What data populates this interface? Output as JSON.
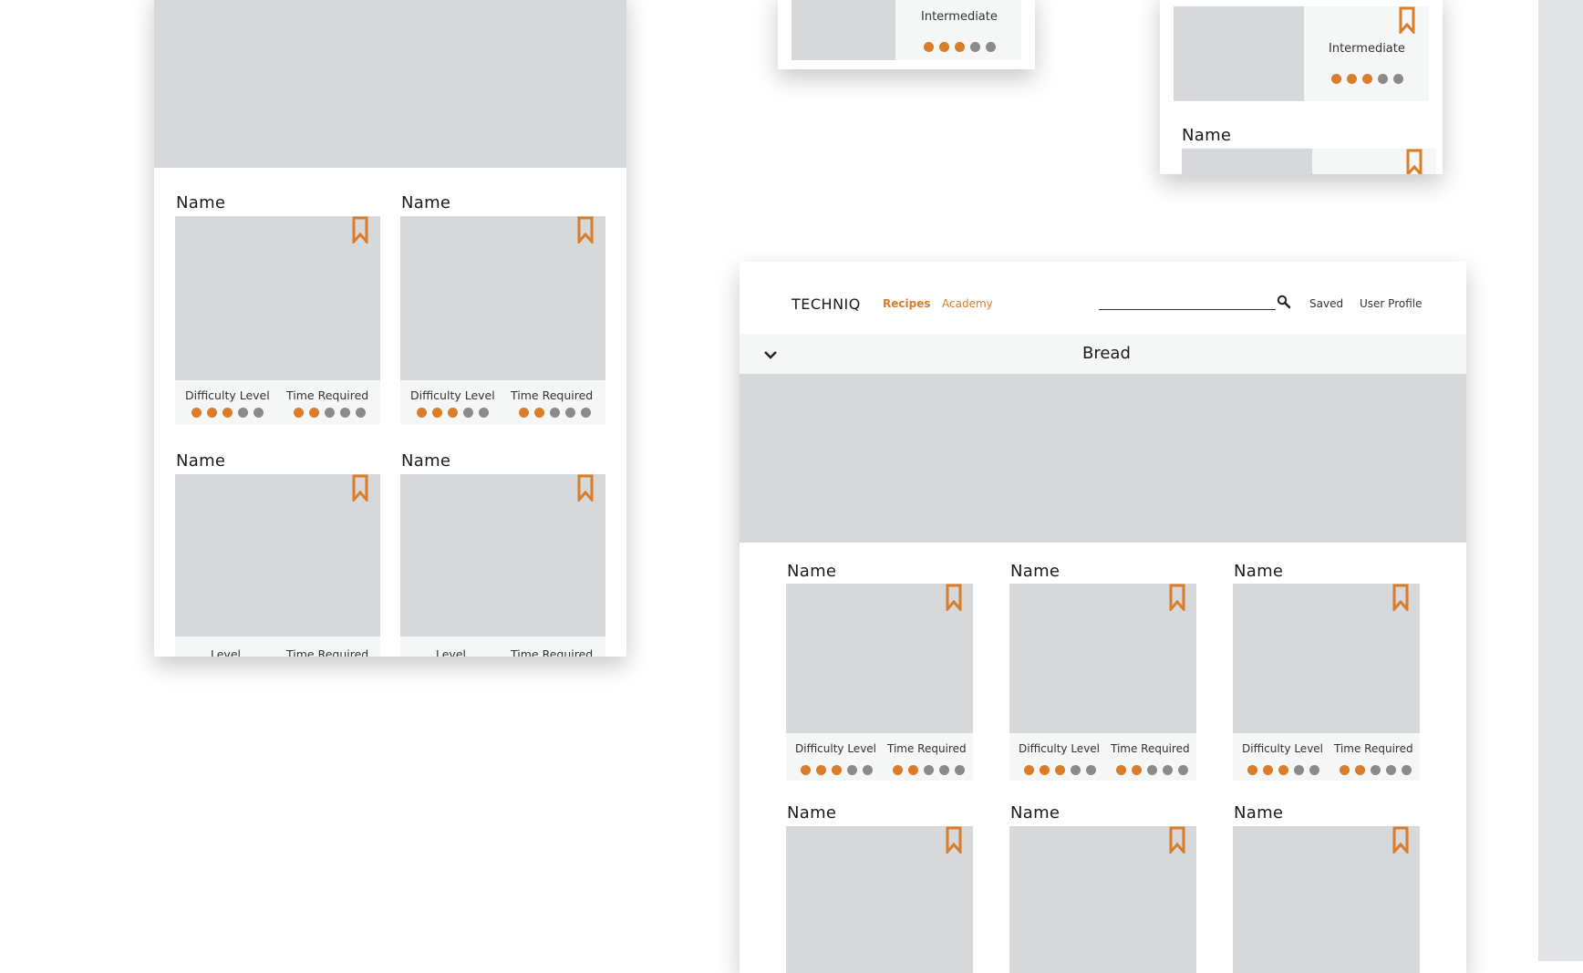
{
  "colors": {
    "accent": "#d97c2b",
    "placeholder": "#d7d8d9",
    "info_bg": "#f5f6f6",
    "dot_off": "#8a8a8a"
  },
  "mobile": {
    "cards": [
      {
        "name": "Name",
        "label_left": "Difficulty Level",
        "label_right": "Time Required",
        "difficulty": 3,
        "time": 2
      },
      {
        "name": "Name",
        "label_left": "Difficulty Level",
        "label_right": "Time Required",
        "difficulty": 3,
        "time": 2
      },
      {
        "name": "Name",
        "label_left": "Level",
        "label_right": "Time Required"
      },
      {
        "name": "Name",
        "label_left": "Level",
        "label_right": "Time Required"
      }
    ]
  },
  "small_frame": {
    "difficulty_text": "Intermediate",
    "rating": 3
  },
  "tablet_frame": {
    "difficulty_text": "Intermediate",
    "rating": 3,
    "next_name": "Name"
  },
  "desktop": {
    "logo": "TECHNIQ",
    "nav": {
      "recipes": "Recipes",
      "academy": "Academy"
    },
    "search": {
      "placeholder": "",
      "icon": "search-icon"
    },
    "links": {
      "saved": "Saved",
      "profile": "User Profile"
    },
    "category": {
      "label": "Bread",
      "icon": "chevron-down-icon"
    },
    "cards": [
      {
        "name": "Name",
        "label_left": "Difficulty Level",
        "label_right": "Time Required",
        "difficulty": 3,
        "time": 2
      },
      {
        "name": "Name",
        "label_left": "Difficulty Level",
        "label_right": "Time Required",
        "difficulty": 3,
        "time": 2
      },
      {
        "name": "Name",
        "label_left": "Difficulty Level",
        "label_right": "Time Required",
        "difficulty": 3,
        "time": 2
      },
      {
        "name": "Name"
      },
      {
        "name": "Name"
      },
      {
        "name": "Name"
      }
    ]
  }
}
